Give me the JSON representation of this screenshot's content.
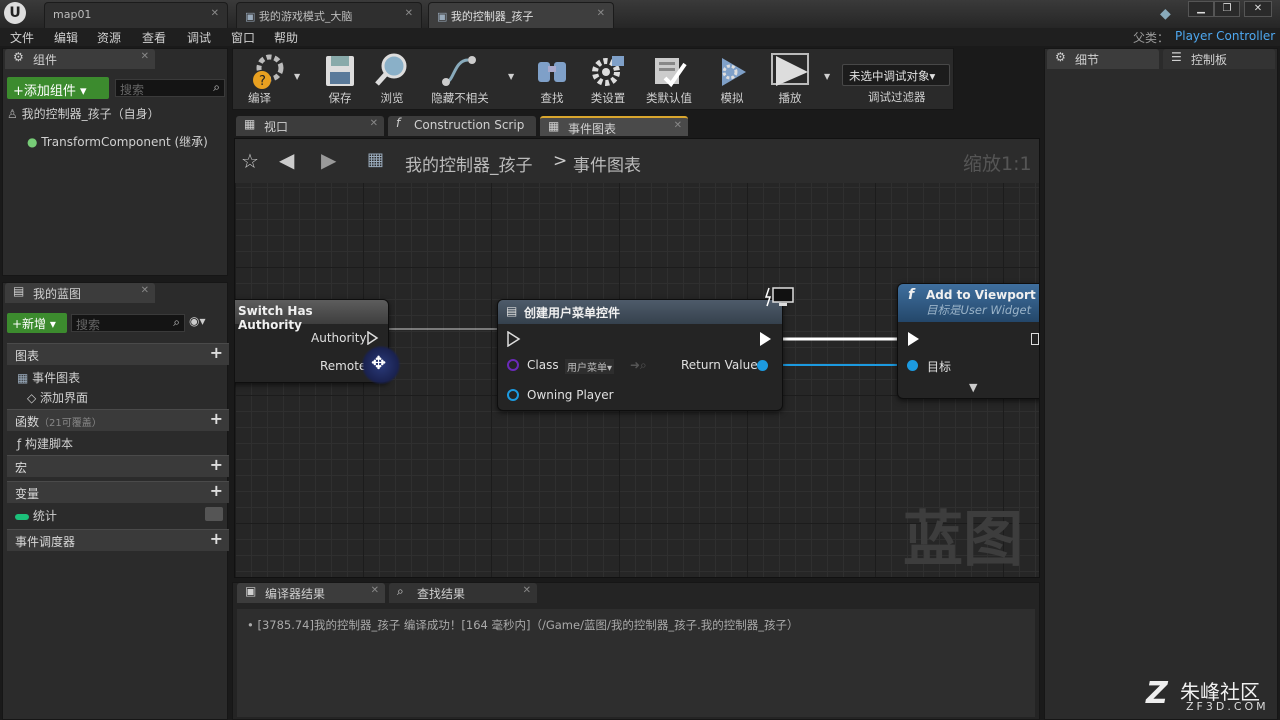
{
  "titlebar": {
    "logo": "U",
    "tabs": [
      {
        "label": "map01",
        "active": false
      },
      {
        "label": "我的游戏模式_大脑",
        "active": false
      },
      {
        "label": "我的控制器_孩子",
        "active": true
      }
    ]
  },
  "menubar": {
    "items": [
      "文件",
      "编辑",
      "资源",
      "查看",
      "调试",
      "窗口",
      "帮助"
    ],
    "parent_label": "父类：",
    "parent_value": "Player Controller"
  },
  "components_panel": {
    "tab": "组件",
    "add_button": "+添加组件 ▾",
    "search_placeholder": "搜索",
    "root": "我的控制器_孩子（自身）",
    "child": "TransformComponent (继承)"
  },
  "toolbar": {
    "buttons": [
      "编译",
      "保存",
      "浏览",
      "隐藏不相关",
      "查找",
      "类设置",
      "类默认值",
      "模拟",
      "播放"
    ],
    "debug_select": "未选中调试对象▾",
    "debug_filter": "调试过滤器"
  },
  "graph_tabs": [
    "视口",
    "Construction Scrip",
    "事件图表"
  ],
  "graph": {
    "breadcrumb_root": "我的控制器_孩子",
    "breadcrumb_sep": ">",
    "breadcrumb_leaf": "事件图表",
    "zoom": "缩放1:1",
    "watermark": "蓝图",
    "nodes": {
      "switch_title": "Switch Has Authority",
      "switch_pins": [
        "Authority",
        "Remote"
      ],
      "create_title": "创建用户菜单控件",
      "create_class_label": "Class",
      "create_class_value": "用户菜单▾",
      "create_owning": "Owning Player",
      "create_return": "Return Value",
      "add_title": "Add to Viewport",
      "add_subtitle": "目标是User Widget",
      "add_target": "目标"
    }
  },
  "mybp_panel": {
    "tab": "我的蓝图",
    "new_button": "+新增 ▾",
    "search_placeholder": "搜索",
    "sections": {
      "graphs": "图表",
      "event_graph": "事件图表",
      "add_ui": "添加界面",
      "functions": "函数",
      "functions_note": "（21可覆盖）",
      "construct": "构建脚本",
      "macros": "宏",
      "variables": "变量",
      "var_item": "统计",
      "dispatchers": "事件调度器"
    }
  },
  "details_panel": {
    "tab": "细节",
    "tab2": "控制板"
  },
  "results": {
    "tabs": [
      "编译器结果",
      "查找结果"
    ],
    "log": "[3785.74]我的控制器_孩子 编译成功！[164 毫秒内]（/Game/蓝图/我的控制器_孩子.我的控制器_孩子）"
  },
  "watermark_brand": {
    "name": "朱峰社区",
    "url": "ZF3D.COM"
  }
}
